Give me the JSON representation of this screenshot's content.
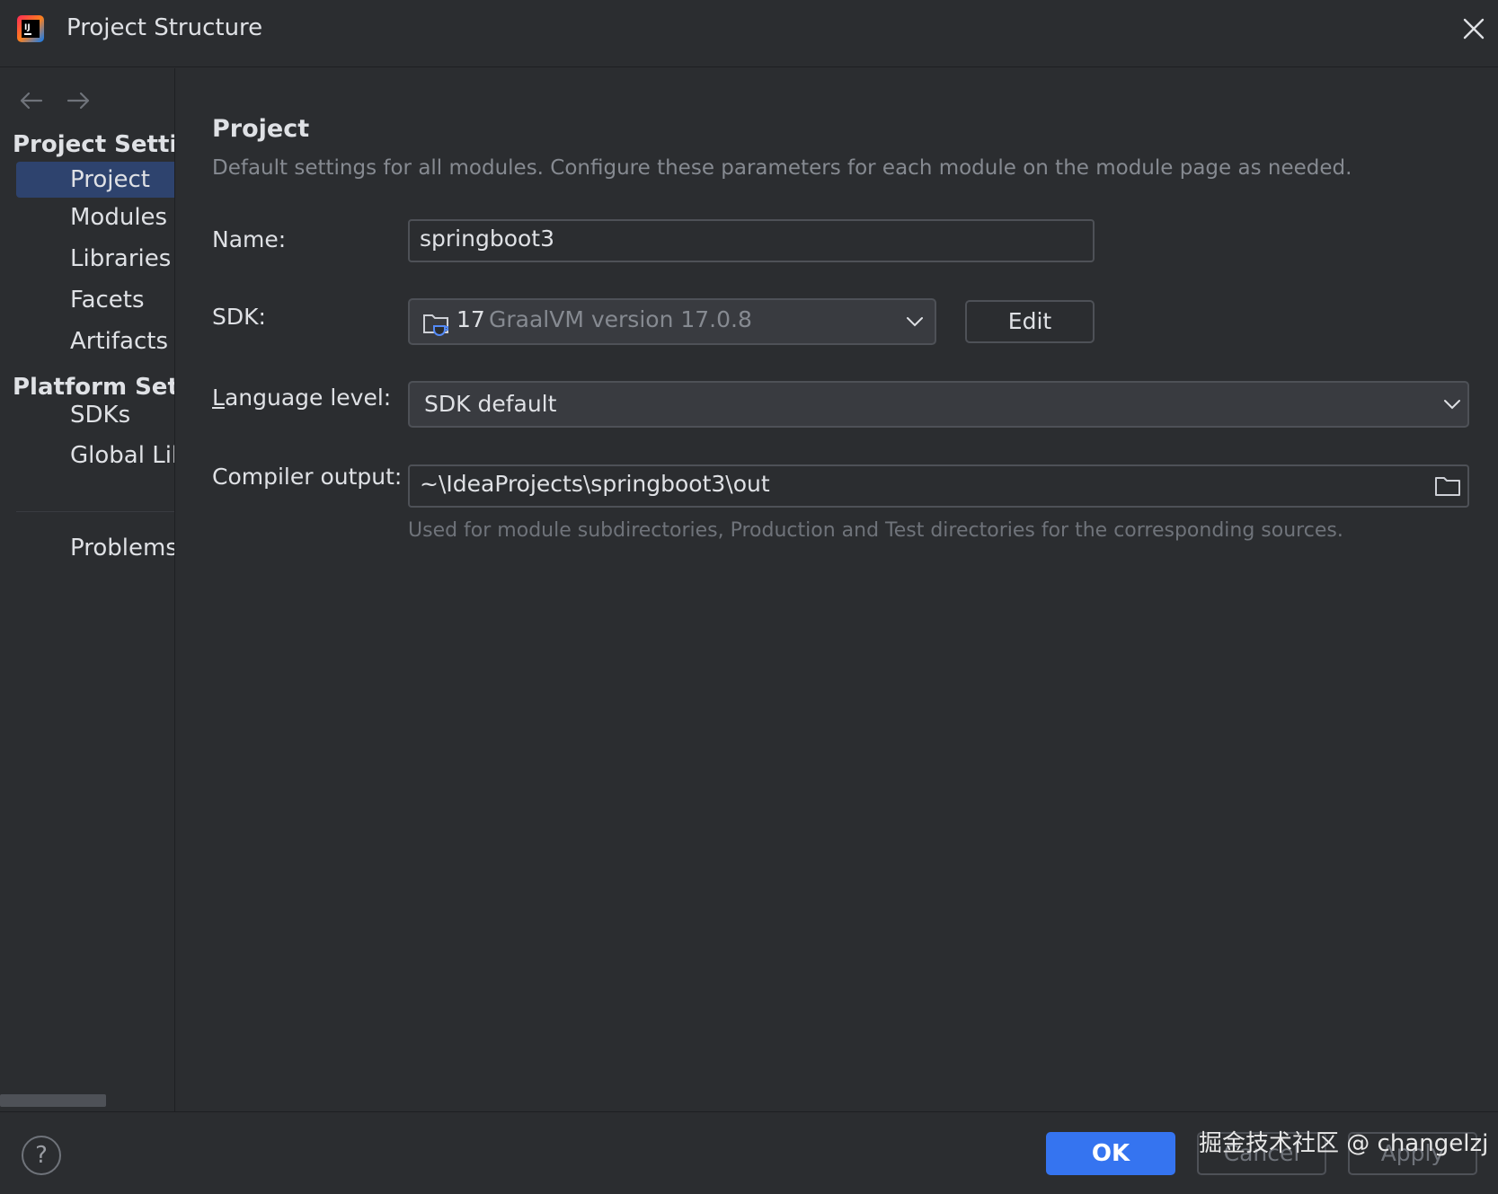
{
  "window": {
    "title": "Project Structure",
    "logo_icon": "intellij-idea-logo",
    "close_icon": "close-icon"
  },
  "sidebar": {
    "back_icon": "arrow-left-icon",
    "forward_icon": "arrow-right-icon",
    "sections": [
      {
        "label": "Project Settin"
      },
      {
        "label": "Platform Setti"
      }
    ],
    "items": [
      {
        "label": "Project",
        "selected": true
      },
      {
        "label": "Modules"
      },
      {
        "label": "Libraries"
      },
      {
        "label": "Facets"
      },
      {
        "label": "Artifacts"
      },
      {
        "label": "SDKs"
      },
      {
        "label": "Global Lib"
      },
      {
        "label": "Problems"
      }
    ]
  },
  "main": {
    "heading": "Project",
    "subheading": "Default settings for all modules. Configure these parameters for each module on the module page as needed.",
    "name": {
      "label": "Name:",
      "value": "springboot3"
    },
    "sdk": {
      "label": "SDK:",
      "version": "17",
      "description": "GraalVM version 17.0.8",
      "icon": "sdk-folder-icon",
      "edit_label": "Edit"
    },
    "language_level": {
      "label_underlined": "L",
      "label_rest": "anguage level:",
      "value": "SDK default"
    },
    "compiler_output": {
      "label": "Compiler output:",
      "value": "~\\IdeaProjects\\springboot3\\out",
      "browse_icon": "folder-icon",
      "hint": "Used for module subdirectories, Production and Test directories for the corresponding sources."
    }
  },
  "footer": {
    "help_label": "?",
    "ok_label": "OK",
    "cancel_label": "Cancel",
    "apply_label": "Apply",
    "watermark": "掘金技术社区 @ changelzj"
  },
  "colors": {
    "background": "#2b2d30",
    "selection": "#2e436e",
    "accent": "#3574f0",
    "muted_text": "#868a91"
  }
}
